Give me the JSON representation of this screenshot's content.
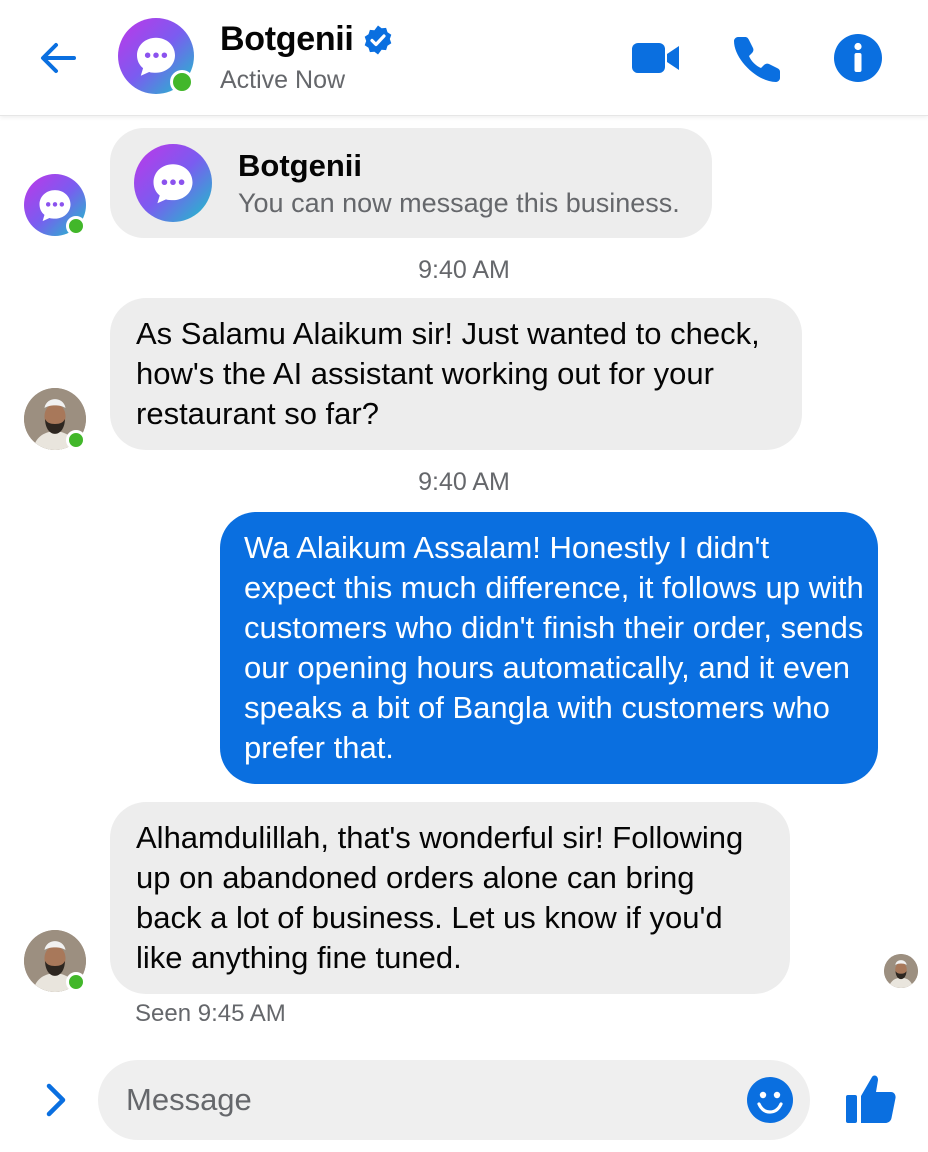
{
  "header": {
    "contact_name": "Botgenii",
    "status": "Active Now",
    "icons": {
      "back": "back-arrow-icon",
      "video": "video-camera-icon",
      "call": "phone-icon",
      "info": "info-icon",
      "verified": "verified-badge-icon"
    }
  },
  "intro_card": {
    "name": "Botgenii",
    "subtitle": "You can now message this business."
  },
  "messages": [
    {
      "timestamp": "9:40 AM",
      "direction": "incoming",
      "text": "As Salamu Alaikum sir! Just wanted to check, how's the AI assistant working out for your restaurant so far?"
    },
    {
      "timestamp": "9:40 AM",
      "direction": "outgoing",
      "text": "Wa Alaikum Assalam! Honestly I didn't expect this much difference, it follows up with customers who didn't finish their order, sends our opening hours automatically, and it even speaks a bit of Bangla with customers who prefer that."
    },
    {
      "direction": "incoming",
      "text": "Alhamdulillah, that's wonderful sir! Following up on abandoned orders alone can bring back a lot of business. Let us know if you'd like anything fine tuned."
    }
  ],
  "seen_label": "Seen 9:45 AM",
  "composer": {
    "placeholder": "Message",
    "value": ""
  },
  "colors": {
    "accent": "#0a6fe0",
    "incoming_bubble": "#ededed",
    "online": "#42b72a",
    "brand_gradient_start": "#b23cf0",
    "brand_gradient_end": "#19c7c7"
  }
}
